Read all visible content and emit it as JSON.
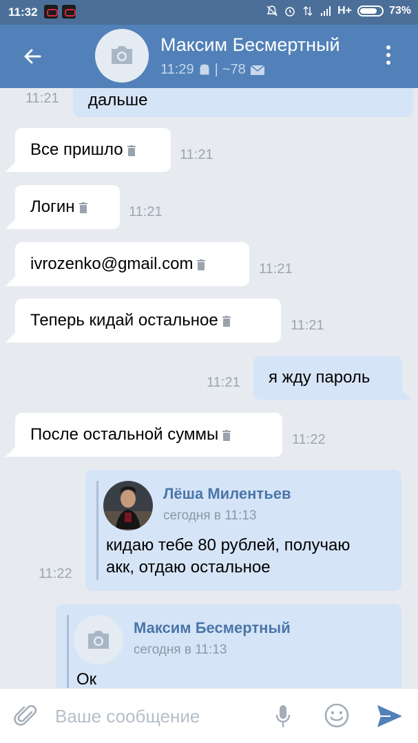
{
  "status_bar": {
    "time": "11:32",
    "network": "H+",
    "battery": "73%"
  },
  "header": {
    "name": "Максим Бесмертный",
    "last_seen": "11:29",
    "separator": "|",
    "count": "~78"
  },
  "messages": [
    {
      "dir": "out",
      "text": "дальше",
      "time": "11:21"
    },
    {
      "dir": "in",
      "text": "Все пришло",
      "time": "11:21"
    },
    {
      "dir": "in",
      "text": "Логин",
      "time": "11:21"
    },
    {
      "dir": "in",
      "text": "ivrozenko@gmail.com",
      "time": "11:21"
    },
    {
      "dir": "in",
      "text": "Теперь кидай остальное",
      "time": "11:21"
    },
    {
      "dir": "out",
      "text": "я жду пароль",
      "time": "11:21"
    },
    {
      "dir": "in",
      "text": "После остальной суммы",
      "time": "11:22"
    }
  ],
  "forwards": [
    {
      "name": "Лёша Милентьев",
      "date": "сегодня в 11:13",
      "text_line1": "кидаю тебе 80 рублей, получаю",
      "text_line2": "акк, отдаю остальное",
      "time": "11:22"
    },
    {
      "name": "Максим Бесмертный",
      "date": "сегодня в 11:13",
      "text": "Ок"
    }
  ],
  "input": {
    "placeholder": "Ваше сообщение"
  },
  "colors": {
    "header": "#5181b8",
    "status_bar": "#4c6f99",
    "outgoing_bubble": "#d6e4f7",
    "incoming_bubble": "#ffffff",
    "background": "#e7ebf0",
    "link": "#4a76a8"
  },
  "icons": [
    "back-arrow-icon",
    "camera-icon",
    "android-icon",
    "mail-icon",
    "more-vert-icon",
    "trash-icon",
    "paperclip-icon",
    "mic-icon",
    "emoji-icon",
    "send-icon"
  ]
}
